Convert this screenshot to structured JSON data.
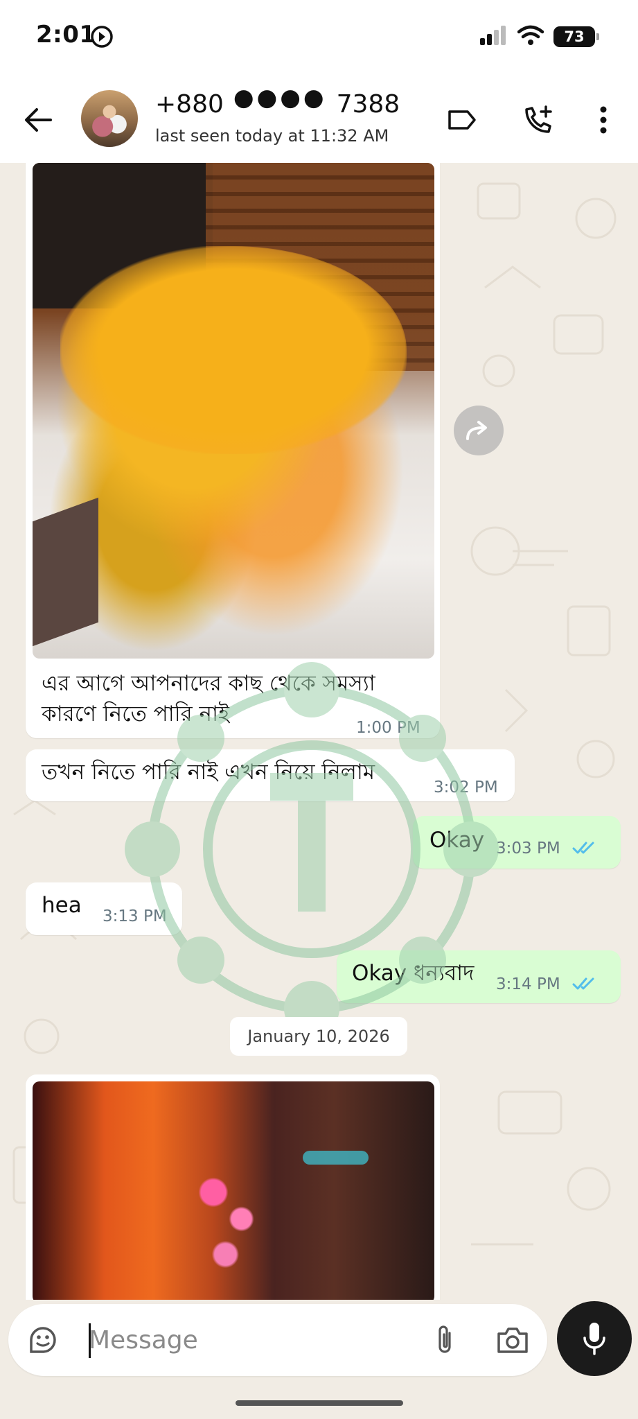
{
  "status_bar": {
    "time": "2:01",
    "battery": "73"
  },
  "header": {
    "name_prefix": "+880",
    "name_masked": "●●●●",
    "name_suffix": "7388",
    "last_seen": "last seen today at 11:32 AM"
  },
  "messages": [
    {
      "type": "image-caption",
      "lines": [
        "এর আগে আপনাদের কাছ থেকে সমস্যা",
        "কারণে নিতে পারি নাই"
      ],
      "time": "1:00 PM",
      "direction": "in"
    },
    {
      "type": "text",
      "text": "তখন নিতে পারি নাই এখন নিয়ে নিলাম",
      "time": "3:02 PM",
      "direction": "in"
    },
    {
      "type": "text",
      "text": "Okay",
      "time": "3:03 PM",
      "direction": "out"
    },
    {
      "type": "text",
      "text": "hea",
      "time": "3:13 PM",
      "direction": "in"
    },
    {
      "type": "text",
      "text": "Okay ধন্যবাদ",
      "time": "3:14 PM",
      "direction": "out"
    }
  ],
  "date_divider": "January 10, 2026",
  "input": {
    "placeholder": "Message"
  },
  "colors": {
    "outgoing_bubble": "#d9fdd3",
    "incoming_bubble": "#ffffff",
    "read_ticks": "#53bdeb",
    "chat_background": "#f1ece4"
  }
}
